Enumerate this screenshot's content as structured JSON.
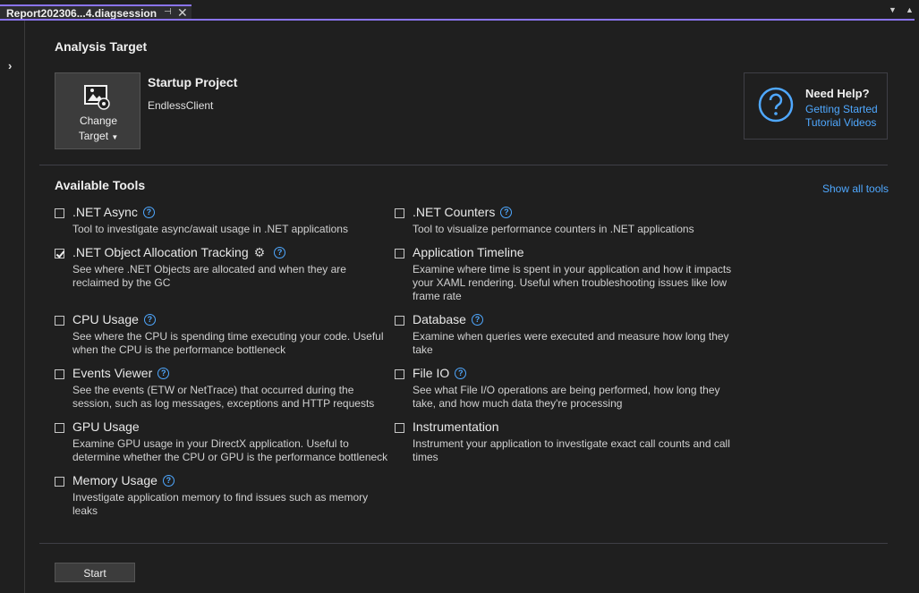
{
  "tab": {
    "title": "Report202306...4.diagsession",
    "pin_icon": "pin-icon",
    "close_icon": "close-icon"
  },
  "analysis_target": {
    "heading": "Analysis Target",
    "change_target_line1": "Change",
    "change_target_line2": "Target",
    "startup_title": "Startup Project",
    "startup_value": "EndlessClient"
  },
  "help": {
    "title": "Need Help?",
    "link1": "Getting Started",
    "link2": "Tutorial Videos"
  },
  "tools_section": {
    "heading": "Available Tools",
    "show_all": "Show all tools"
  },
  "tools_left": [
    {
      "name": ".NET Async",
      "desc": "Tool to investigate async/await usage in .NET applications",
      "checked": false,
      "gear": false
    },
    {
      "name": ".NET Object Allocation Tracking",
      "desc": "See where .NET Objects are allocated and when they are reclaimed by the GC",
      "checked": true,
      "gear": true
    },
    {
      "name": "CPU Usage",
      "desc": "See where the CPU is spending time executing your code. Useful when the CPU is the performance bottleneck",
      "checked": false,
      "gear": false
    },
    {
      "name": "Events Viewer",
      "desc": "See the events (ETW or NetTrace) that occurred during the session, such as log messages, exceptions and HTTP requests",
      "checked": false,
      "gear": false
    },
    {
      "name": "GPU Usage",
      "desc": "Examine GPU usage in your DirectX application. Useful to determine whether the CPU or GPU is the performance bottleneck",
      "checked": false,
      "gear": false
    },
    {
      "name": "Memory Usage",
      "desc": "Investigate application memory to find issues such as memory leaks",
      "checked": false,
      "gear": false
    }
  ],
  "tools_right": [
    {
      "name": ".NET Counters",
      "desc": "Tool to visualize performance counters in .NET applications",
      "checked": false,
      "help": true
    },
    {
      "name": "Application Timeline",
      "desc": "Examine where time is spent in your application and how it impacts your XAML rendering. Useful when troubleshooting issues like low frame rate",
      "checked": false,
      "help": false
    },
    {
      "name": "Database",
      "desc": "Examine when queries were executed and measure how long they take",
      "checked": false,
      "help": true
    },
    {
      "name": "File IO",
      "desc": "See what File I/O operations are being performed, how long they take, and how much data they're processing",
      "checked": false,
      "help": true
    },
    {
      "name": "Instrumentation",
      "desc": "Instrument your application to investigate exact call counts and call times",
      "checked": false,
      "help": false
    }
  ],
  "start_label": "Start"
}
